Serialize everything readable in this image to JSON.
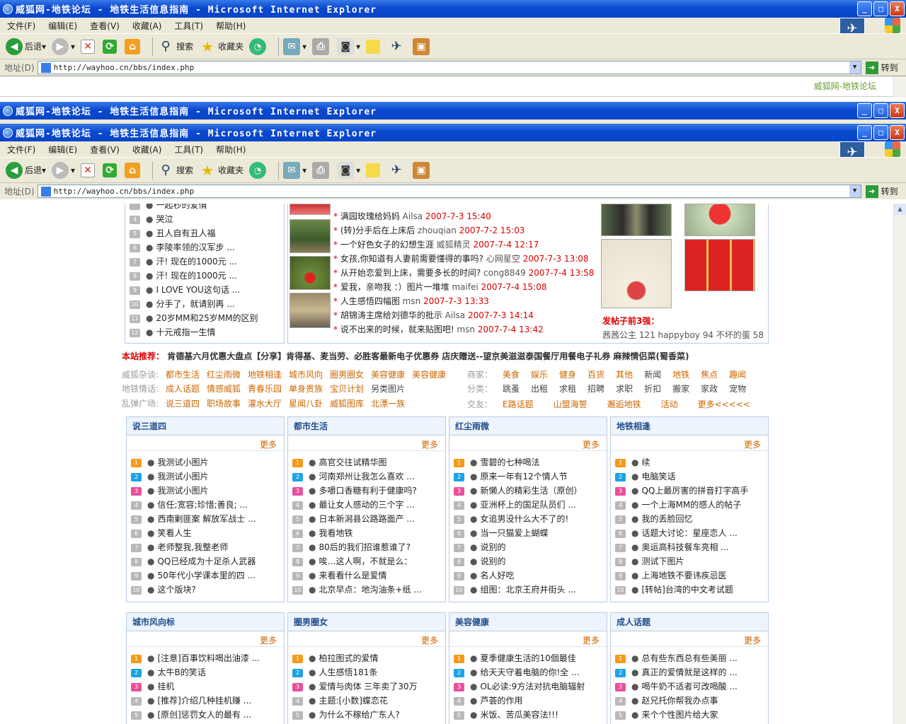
{
  "window": {
    "title": "威狐网-地铁论坛 - 地铁生活信息指南 - Microsoft Internet Explorer",
    "buttons": {
      "min": "_",
      "max": "□",
      "close": "X"
    }
  },
  "menu": [
    "文件(F)",
    "编辑(E)",
    "查看(V)",
    "收藏(A)",
    "工具(T)",
    "帮助(H)"
  ],
  "toolbar": {
    "back": "后退",
    "search": "搜索",
    "favorites": "收藏夹"
  },
  "address": {
    "label": "地址(D)",
    "url": "http://wayhoo.cn/bbs/index.php",
    "go": "转到"
  },
  "stub_link": "威狐网-地铁论坛",
  "top_left_list": [
    {
      "n": "",
      "t": "一起秒的爱情"
    },
    {
      "n": "4",
      "t": "哭泣"
    },
    {
      "n": "5",
      "t": "丑人自有丑人福"
    },
    {
      "n": "6",
      "t": "李陵率领的汉军步 ..."
    },
    {
      "n": "7",
      "t": "汗! 现在的1000元 ..."
    },
    {
      "n": "8",
      "t": "汗! 现在的1000元 ..."
    },
    {
      "n": "9",
      "t": "I LOVE YOU这句话 ..."
    },
    {
      "n": "10",
      "t": "分手了，就请别再 ..."
    },
    {
      "n": "11",
      "t": "20岁MM和25岁MM的区别"
    },
    {
      "n": "12",
      "t": "十元戒指一生情"
    }
  ],
  "top_mid_list": [
    {
      "t": "满园玫瑰给妈妈",
      "u": "Ailsa",
      "d": "2007-7-3 15:40"
    },
    {
      "t": "(转)分手后在上床后",
      "u": "zhouqian",
      "d": "2007-7-2 15:03"
    },
    {
      "t": "一个好色女子的幻想生涯",
      "u": "威狐精灵",
      "d": "2007-7-4 12:17"
    },
    {
      "t": "女孩,你知道有人妻前需要懂得的事吗?",
      "u": "心网星空",
      "d": "2007-7-3 13:08"
    },
    {
      "t": "从开始恋爱到上床，需要多长的时间?",
      "u": "cong8849",
      "d": "2007-7-4 13:58"
    },
    {
      "t": "爱我，亲吻我 ：）图片一堆堆",
      "u": "maifei",
      "d": "2007-7-4 15:08"
    },
    {
      "t": "人生感悟四幅图",
      "u": "msn",
      "d": "2007-7-3 13:33"
    },
    {
      "t": "胡锦涛主席给刘德华的批示",
      "u": "Ailsa",
      "d": "2007-7-3 14:14"
    },
    {
      "t": "说不出来的时候，就来贴图吧!",
      "u": "msn",
      "d": "2007-7-4 13:42"
    }
  ],
  "top3": {
    "title": "发帖子前3强：",
    "text": "茜茜公主 121 happyboy 94 不坏的蛋 58"
  },
  "recommend": {
    "label": "本站推荐：",
    "text": "肯德基六月优惠大盘点【分享】肯得基、麦当劳、必胜客最新电子优惠券 店庆赠送--望京美滋滋泰国餐厅用餐电子礼券 麻辣情侣菜(蜀香菜)"
  },
  "cats": {
    "row1": {
      "k": "威狐杂谈:",
      "v": [
        "都市生活",
        "红尘雨微",
        "地铁相逢",
        "城市风向",
        "圈男圈女",
        "美容健康",
        "美容健康"
      ]
    },
    "row2": {
      "k": "地铁情话:",
      "v": [
        "成人话题",
        "情感威狐",
        "青春乐园",
        "单身贵族",
        "宝贝计划",
        "另类图片"
      ]
    },
    "row3": {
      "k": "乱弹广场:",
      "v": [
        "说三道四",
        "职场故事",
        "灌水大厅",
        "星闻八卦",
        "威狐图库",
        "北漂一族"
      ]
    },
    "shop": {
      "k": "商家：",
      "v": [
        "美食",
        "娱乐",
        "健身",
        "百货",
        "其他",
        "新闻",
        "地铁",
        "焦点",
        "趣闻"
      ]
    },
    "fenlei": {
      "k": "分类：",
      "v": [
        "跳蚤",
        "出租",
        "求租",
        "招聘",
        "求职",
        "折扣",
        "搬家",
        "家政",
        "宠物"
      ]
    },
    "jiaoyou": {
      "k": "交友：",
      "v": [
        "E路话题",
        "山盟海誓",
        "邂逅地铁",
        "活动",
        "更多<<<<<"
      ]
    }
  },
  "more_label": "更多",
  "boards_row1": [
    {
      "title": "说三道四",
      "items": [
        "我测试小图片",
        "我测试小图片",
        "我测试小图片",
        "信任;宽容;珍惜;善良; ...",
        "西南剿匪案 解放军战士 ...",
        "笑看人生",
        "老师整我,我整老师",
        "QQ已经成为十足杀人武器",
        "50年代小学课本里的四 ...",
        "这个版块?"
      ]
    },
    {
      "title": "都市生活",
      "items": [
        "高官交往试精华图",
        "河南郑州让我怎么喜欢 ...",
        "多嚼口香糖有利于健康吗?",
        "最让女人感动的三个字 ...",
        "日本新潟县公路路面产 ...",
        "我看地铁",
        "80后的我们招谁惹谁了?",
        "唉…这人啊，不就是么：",
        "来看看什么是爱情",
        "北京早点：地沟油条+纸 ..."
      ]
    },
    {
      "title": "红尘雨微",
      "items": [
        "雪碧的七种喝法",
        "原来一年有12个情人节",
        "新懒人的精彩生活（原创）",
        "亚洲杯上的国足队员们 ...",
        "女追男没什么大不了的!",
        "当一只猫爱上蝴蝶",
        "说别的",
        "说别的",
        "名人好吃",
        "组图：北京王府井街头 ..."
      ]
    },
    {
      "title": "地铁相逢",
      "items": [
        "续",
        "电脑笑话",
        "QQ上最厉害的拼音打字高手",
        "一个上海MM的感人的帖子",
        "我的丢脸回忆",
        "话题大讨论：星座恋人 ...",
        "奥运高科技餐车亮相 ...",
        "测试下图片",
        "上海地铁不要讳疾忌医",
        "[转帖]台湾的中文考试题"
      ]
    }
  ],
  "boards_row2": [
    {
      "title": "城市风向标",
      "items": [
        "[注意]百事饮料喝出油漆 ...",
        "太牛B的笑话",
        "挂机",
        "[推荐]介绍几种挂机赚 ...",
        "[原创]惩罚女人的最有 ..."
      ]
    },
    {
      "title": "圈男圈女",
      "items": [
        "柏拉图式的爱情",
        "人生感悟181条",
        "爱情与肉体 三年卖了30万",
        "主题:[小数]蝶恋花",
        "为什么不稼给广东人?"
      ]
    },
    {
      "title": "美容健康",
      "items": [
        "夏季健康生活的10個最佳",
        "给天天守着电脑的你!全 ...",
        "OL必读:9方法对抗电脑辐射",
        "芦荟的作用",
        "米饭、苦瓜美容法!!!"
      ]
    },
    {
      "title": "成人话题",
      "items": [
        "总有些东西总有些美丽 ...",
        "真正的爱情就是这样的 ...",
        "喝牛奶不适者可改喝酸 ...",
        "赵兄托你帮我办点事",
        "来个个性图片给大家"
      ]
    }
  ],
  "colors": {
    "title_blue": "#0a48d0",
    "accent_orange": "#cc6600",
    "date_red": "#dd0000",
    "board_blue": "#1f4d8c"
  }
}
